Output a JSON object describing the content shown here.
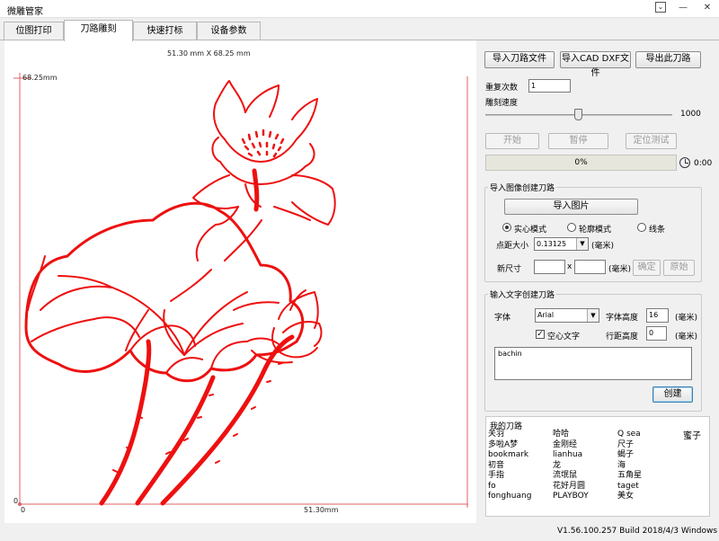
{
  "window": {
    "title": "微雕管家"
  },
  "tabs": [
    {
      "label": "位图打印",
      "active": false
    },
    {
      "label": "刀路雕刻",
      "active": true
    },
    {
      "label": "快速打标",
      "active": false
    },
    {
      "label": "设备参数",
      "active": false
    }
  ],
  "canvas": {
    "dimensions_label": "51.30 mm X 68.25 mm",
    "y_max_label": "68.25mm",
    "y_zero_label": "0",
    "x_zero_label": "0",
    "x_max_label": "51.30mm",
    "drawing_color": "#ee1010"
  },
  "toolbar": {
    "import_path_file": "导入刀路文件",
    "import_cad_dxf": "导入CAD DXF文件",
    "export_path": "导出此刀路"
  },
  "engrave": {
    "repeat_label": "重复次数",
    "repeat_value": "1",
    "speed_label": "雕刻速度",
    "speed_value": "1000",
    "speed_fraction": 0.5,
    "start_button": "开始",
    "pause_button": "暂停",
    "position_test_button": "定位测试",
    "progress_text": "0%",
    "progress_value": 0,
    "elapsed_time": "0:00"
  },
  "image_group": {
    "title": "导入图像创建刀路",
    "import_image_button": "导入图片",
    "modes": [
      {
        "label": "实心模式",
        "checked": true
      },
      {
        "label": "轮廓模式",
        "checked": false
      },
      {
        "label": "线条",
        "checked": false
      }
    ],
    "dot_size_label": "点距大小",
    "dot_size_value": "0.13125",
    "dot_unit": "(毫米)",
    "new_size_label": "新尺寸",
    "size_sep": "x",
    "size_unit": "(毫米)",
    "confirm_button": "确定",
    "original_button": "原始"
  },
  "text_group": {
    "title": "输入文字创建刀路",
    "font_label": "字体",
    "font_value": "Arial",
    "font_height_label": "字体高度",
    "font_height_value": "16",
    "font_height_unit": "(毫米)",
    "hollow_label": "空心文字",
    "hollow_checked": true,
    "line_spacing_label": "行距高度",
    "line_spacing_value": "0",
    "line_spacing_unit": "(毫米)",
    "text_value": "bachin",
    "create_button": "创建"
  },
  "my_paths": {
    "title": "我的刀路",
    "columns": [
      [
        "关羽",
        "多啦A梦",
        "bookmark",
        "初音",
        "手指",
        "fo",
        "fonghuang"
      ],
      [
        "哈哈",
        "金刚经",
        "lianhua",
        "龙",
        "流氓鼠",
        "花好月圆",
        "PLAYBOY"
      ],
      [
        "Q sea",
        "尺子",
        "蝎子",
        "海",
        "五角星",
        "taget",
        "美女"
      ],
      [
        "蜜子"
      ]
    ]
  },
  "status": {
    "version": "V1.56.100.257 Build 2018/4/3 Windows 10"
  }
}
